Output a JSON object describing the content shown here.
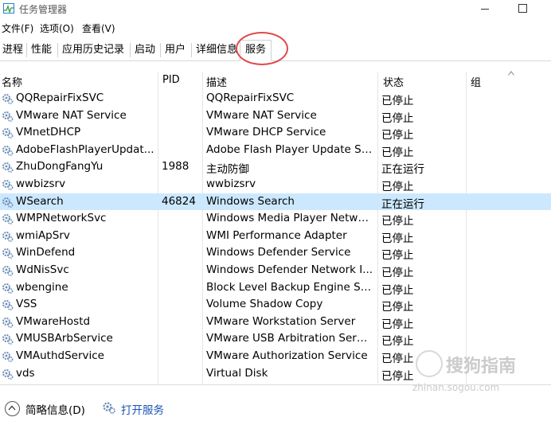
{
  "window": {
    "title": "任务管理器"
  },
  "menu": [
    "文件(F)",
    "选项(O)",
    "查看(V)"
  ],
  "tabs": [
    {
      "label": "进程",
      "active": false
    },
    {
      "label": "性能",
      "active": false
    },
    {
      "label": "应用历史记录",
      "active": false
    },
    {
      "label": "启动",
      "active": false
    },
    {
      "label": "用户",
      "active": false
    },
    {
      "label": "详细信息",
      "active": false
    },
    {
      "label": "服务",
      "active": true
    }
  ],
  "columns": {
    "name": "名称",
    "pid": "PID",
    "desc": "描述",
    "status": "状态",
    "group": "组"
  },
  "services": [
    {
      "name": "QQRepairFixSVC",
      "pid": "",
      "desc": "QQRepairFixSVC",
      "status": "已停止"
    },
    {
      "name": "VMware NAT Service",
      "pid": "",
      "desc": "VMware NAT Service",
      "status": "已停止"
    },
    {
      "name": "VMnetDHCP",
      "pid": "",
      "desc": "VMware DHCP Service",
      "status": "已停止"
    },
    {
      "name": "AdobeFlashPlayerUpdat...",
      "pid": "",
      "desc": "Adobe Flash Player Update Se...",
      "status": "已停止"
    },
    {
      "name": "ZhuDongFangYu",
      "pid": "1988",
      "desc": "主动防御",
      "status": "正在运行"
    },
    {
      "name": "wwbizsrv",
      "pid": "",
      "desc": "wwbizsrv",
      "status": "已停止"
    },
    {
      "name": "WSearch",
      "pid": "46824",
      "desc": "Windows Search",
      "status": "正在运行",
      "selected": true
    },
    {
      "name": "WMPNetworkSvc",
      "pid": "",
      "desc": "Windows Media Player Netwo...",
      "status": "已停止"
    },
    {
      "name": "wmiApSrv",
      "pid": "",
      "desc": "WMI Performance Adapter",
      "status": "已停止"
    },
    {
      "name": "WinDefend",
      "pid": "",
      "desc": "Windows Defender Service",
      "status": "已停止"
    },
    {
      "name": "WdNisSvc",
      "pid": "",
      "desc": "Windows Defender Network I...",
      "status": "已停止"
    },
    {
      "name": "wbengine",
      "pid": "",
      "desc": "Block Level Backup Engine Ser...",
      "status": "已停止"
    },
    {
      "name": "VSS",
      "pid": "",
      "desc": "Volume Shadow Copy",
      "status": "已停止"
    },
    {
      "name": "VMwareHostd",
      "pid": "",
      "desc": "VMware Workstation Server",
      "status": "已停止"
    },
    {
      "name": "VMUSBArbService",
      "pid": "",
      "desc": "VMware USB Arbitration Servi...",
      "status": "已停止"
    },
    {
      "name": "VMAuthdService",
      "pid": "",
      "desc": "VMware Authorization Service",
      "status": "已停止"
    },
    {
      "name": "vds",
      "pid": "",
      "desc": "Virtual Disk",
      "status": "已停止"
    }
  ],
  "footer": {
    "brief": "简略信息(D)",
    "open_services": "打开服务"
  },
  "watermark": {
    "text": "搜狗指南",
    "sub": "zhinan.sogou.com"
  },
  "colors": {
    "selection": "#cce8ff",
    "link": "#1a55b5",
    "highlight": "#e04848"
  }
}
